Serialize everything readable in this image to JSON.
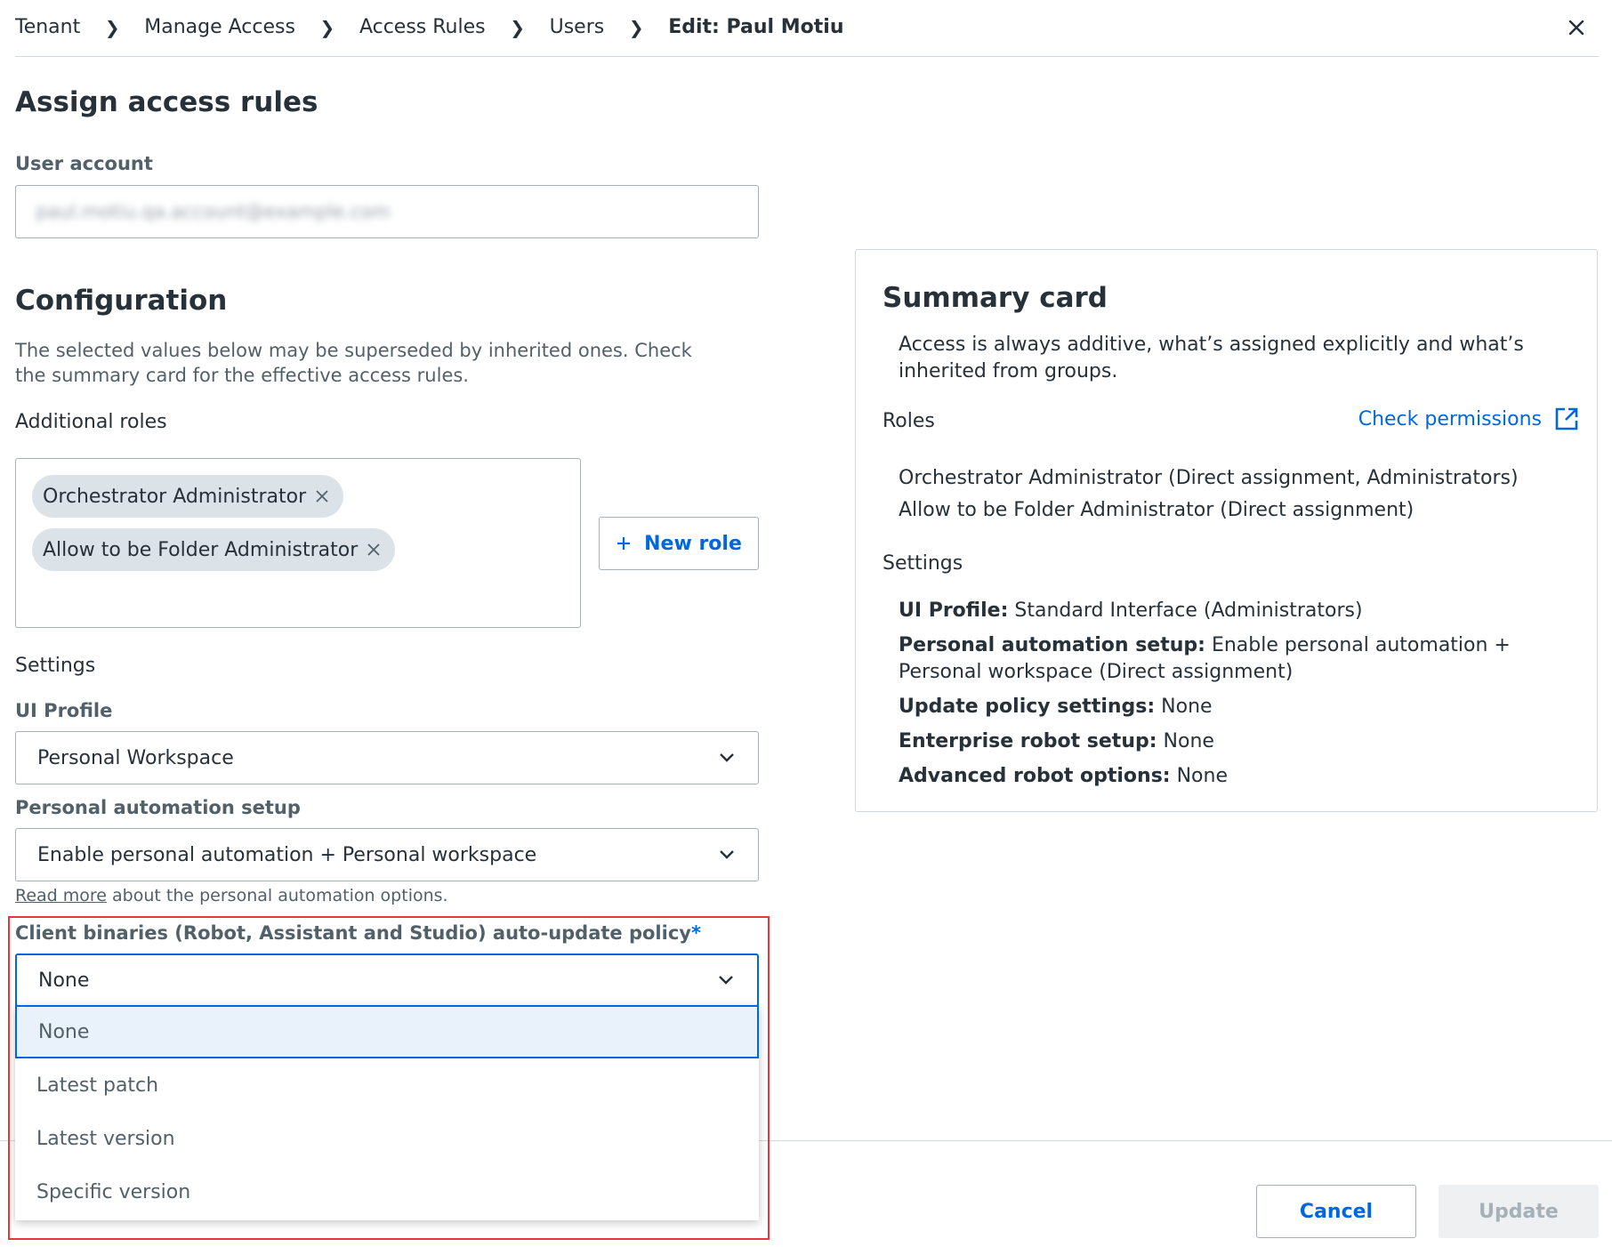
{
  "breadcrumb": {
    "items": [
      "Tenant",
      "Manage Access",
      "Access Rules",
      "Users",
      "Edit: Paul Motiu"
    ]
  },
  "page": {
    "title": "Assign access rules"
  },
  "user_account": {
    "label": "User account",
    "value": "paul.motiu.qa.account@example.com"
  },
  "configuration": {
    "title": "Configuration",
    "help": "The selected values below may be superseded by inherited ones. Check the summary card for the effective access rules.",
    "additional_roles_label": "Additional roles",
    "roles": [
      "Orchestrator Administrator",
      "Allow to be Folder Administrator"
    ],
    "new_role_label": "New role",
    "settings_label": "Settings",
    "ui_profile": {
      "label": "UI Profile",
      "value": "Personal Workspace"
    },
    "personal_automation": {
      "label": "Personal automation setup",
      "value": "Enable personal automation + Personal workspace",
      "read_more": "Read more",
      "read_more_suffix": " about the personal automation options."
    },
    "auto_update": {
      "label": "Client binaries (Robot, Assistant and Studio) auto-update policy",
      "required": "*",
      "value": "None",
      "options": [
        "None",
        "Latest patch",
        "Latest version",
        "Specific version"
      ]
    }
  },
  "summary": {
    "title": "Summary card",
    "description": "Access is always additive, what’s assigned explicitly and what’s inherited from groups.",
    "roles_label": "Roles",
    "check_permissions": "Check permissions",
    "roles": [
      "Orchestrator Administrator (Direct assignment, Administrators)",
      "Allow to be Folder Administrator (Direct assignment)"
    ],
    "settings_label": "Settings",
    "settings": [
      {
        "key": "UI Profile:",
        "value": " Standard Interface (Administrators)"
      },
      {
        "key": "Personal automation setup:",
        "value": " Enable personal automation + Personal workspace (Direct assignment)"
      },
      {
        "key": "Update policy settings:",
        "value": " None"
      },
      {
        "key": "Enterprise robot setup:",
        "value": " None"
      },
      {
        "key": "Advanced robot options:",
        "value": " None"
      }
    ]
  },
  "footer": {
    "cancel": "Cancel",
    "update": "Update"
  },
  "colors": {
    "accent": "#0067df",
    "highlight": "#e8363b",
    "text": "#273139"
  }
}
